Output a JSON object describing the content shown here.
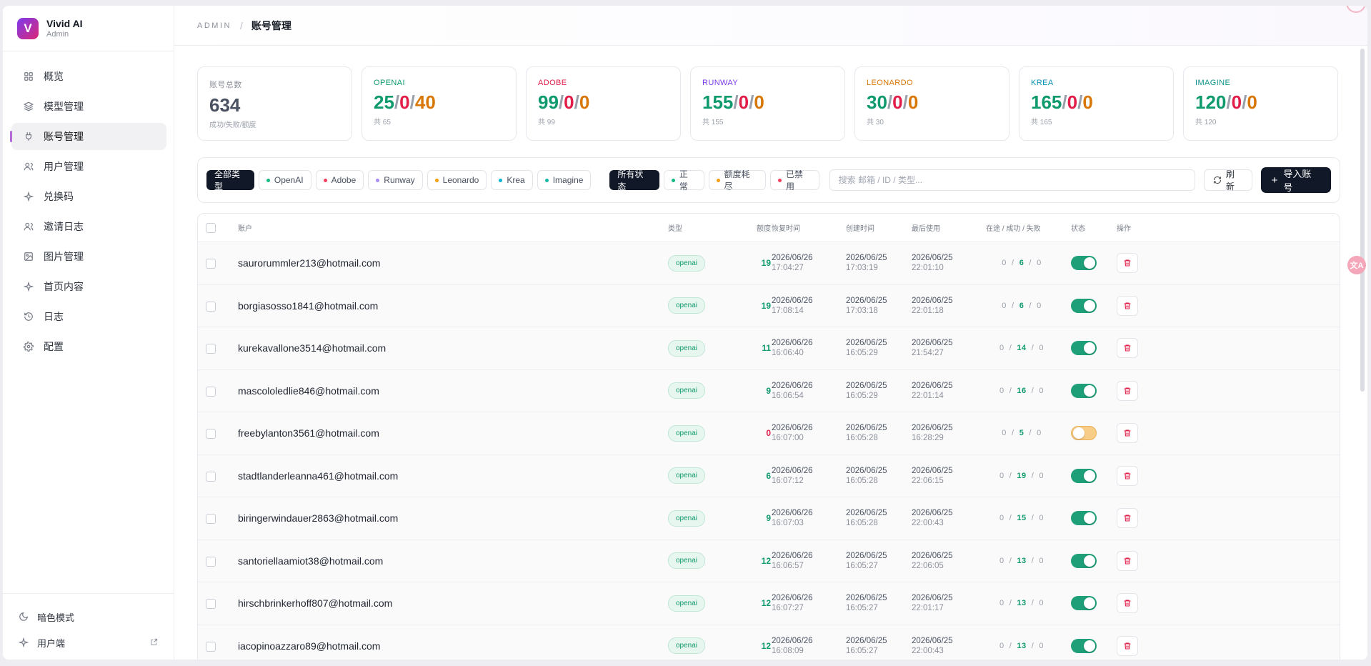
{
  "brand": {
    "name": "Vivid AI",
    "role": "Admin",
    "logo_letter": "V"
  },
  "nav": [
    {
      "label": "概览",
      "icon": "grid-icon",
      "active": false
    },
    {
      "label": "模型管理",
      "icon": "layers-icon",
      "active": false
    },
    {
      "label": "账号管理",
      "icon": "plug-icon",
      "active": true
    },
    {
      "label": "用户管理",
      "icon": "users-icon",
      "active": false
    },
    {
      "label": "兑换码",
      "icon": "sparkle-icon",
      "active": false
    },
    {
      "label": "邀请日志",
      "icon": "users-icon",
      "active": false
    },
    {
      "label": "图片管理",
      "icon": "image-icon",
      "active": false
    },
    {
      "label": "首页内容",
      "icon": "sparkle-icon",
      "active": false
    },
    {
      "label": "日志",
      "icon": "history-icon",
      "active": false
    },
    {
      "label": "配置",
      "icon": "gear-icon",
      "active": false
    }
  ],
  "sidebar_bottom": {
    "dark_mode": "暗色模式",
    "user_side": "用户端"
  },
  "breadcrumb": {
    "admin": "ADMIN",
    "sep": "/",
    "page": "账号管理"
  },
  "stats": [
    {
      "label": "账号总数",
      "label_color": "#8b8f99",
      "value_parts": [
        {
          "text": "634",
          "color": "#4a5160"
        }
      ],
      "sub": "成功/失败/额度"
    },
    {
      "label": "OPENAI",
      "label_color": "#0f9a6d",
      "value_parts": [
        {
          "text": "25",
          "color": "#0f9a6d"
        },
        {
          "text": "/",
          "color": "#9aa0aa"
        },
        {
          "text": "0",
          "color": "#e11d48"
        },
        {
          "text": "/",
          "color": "#9aa0aa"
        },
        {
          "text": "40",
          "color": "#d97706"
        }
      ],
      "sub": "共 65"
    },
    {
      "label": "ADOBE",
      "label_color": "#e11d48",
      "value_parts": [
        {
          "text": "99",
          "color": "#0f9a6d"
        },
        {
          "text": "/",
          "color": "#9aa0aa"
        },
        {
          "text": "0",
          "color": "#e11d48"
        },
        {
          "text": "/",
          "color": "#9aa0aa"
        },
        {
          "text": "0",
          "color": "#d97706"
        }
      ],
      "sub": "共 99"
    },
    {
      "label": "RUNWAY",
      "label_color": "#7c3aed",
      "value_parts": [
        {
          "text": "155",
          "color": "#0f9a6d"
        },
        {
          "text": "/",
          "color": "#9aa0aa"
        },
        {
          "text": "0",
          "color": "#e11d48"
        },
        {
          "text": "/",
          "color": "#9aa0aa"
        },
        {
          "text": "0",
          "color": "#d97706"
        }
      ],
      "sub": "共 155"
    },
    {
      "label": "LEONARDO",
      "label_color": "#d97706",
      "value_parts": [
        {
          "text": "30",
          "color": "#0f9a6d"
        },
        {
          "text": "/",
          "color": "#9aa0aa"
        },
        {
          "text": "0",
          "color": "#e11d48"
        },
        {
          "text": "/",
          "color": "#9aa0aa"
        },
        {
          "text": "0",
          "color": "#d97706"
        }
      ],
      "sub": "共 30"
    },
    {
      "label": "KREA",
      "label_color": "#0891b2",
      "value_parts": [
        {
          "text": "165",
          "color": "#0f9a6d"
        },
        {
          "text": "/",
          "color": "#9aa0aa"
        },
        {
          "text": "0",
          "color": "#e11d48"
        },
        {
          "text": "/",
          "color": "#9aa0aa"
        },
        {
          "text": "0",
          "color": "#d97706"
        }
      ],
      "sub": "共 165"
    },
    {
      "label": "IMAGINE",
      "label_color": "#0d9488",
      "value_parts": [
        {
          "text": "120",
          "color": "#0f9a6d"
        },
        {
          "text": "/",
          "color": "#9aa0aa"
        },
        {
          "text": "0",
          "color": "#e11d48"
        },
        {
          "text": "/",
          "color": "#9aa0aa"
        },
        {
          "text": "0",
          "color": "#d97706"
        }
      ],
      "sub": "共 120"
    }
  ],
  "type_filters": [
    {
      "label": "全部类型",
      "selected": true,
      "dot": ""
    },
    {
      "label": "OpenAI",
      "selected": false,
      "dot": "#10b981"
    },
    {
      "label": "Adobe",
      "selected": false,
      "dot": "#f43f5e"
    },
    {
      "label": "Runway",
      "selected": false,
      "dot": "#a78bfa"
    },
    {
      "label": "Leonardo",
      "selected": false,
      "dot": "#f59e0b"
    },
    {
      "label": "Krea",
      "selected": false,
      "dot": "#06b6d4"
    },
    {
      "label": "Imagine",
      "selected": false,
      "dot": "#14b8a6"
    }
  ],
  "status_filters": [
    {
      "label": "所有状态",
      "selected": true,
      "dot": ""
    },
    {
      "label": "正常",
      "selected": false,
      "dot": "#10b981"
    },
    {
      "label": "额度耗尽",
      "selected": false,
      "dot": "#f59e0b"
    },
    {
      "label": "已禁用",
      "selected": false,
      "dot": "#f43f5e"
    }
  ],
  "search": {
    "placeholder": "搜索 邮箱 / ID / 类型...",
    "value": ""
  },
  "buttons": {
    "refresh": "刷新",
    "import": "导入账号"
  },
  "table": {
    "headers": {
      "account": "账户",
      "type": "类型",
      "quota": "额度",
      "recover": "恢复时间",
      "created": "创建时间",
      "last_used": "最后使用",
      "counts": "在途 / 成功 / 失败",
      "status": "状态",
      "actions": "操作"
    },
    "rows": [
      {
        "email": "saurorummler213@hotmail.com",
        "type": "openai",
        "quota": "19",
        "recover_date": "2026/06/26",
        "recover_time": "17:04:27",
        "created_date": "2026/06/25",
        "created_time": "17:03:19",
        "last_date": "2026/06/25",
        "last_time": "22:01:10",
        "inflight": "0",
        "success": "6",
        "fail": "0",
        "enabled": true
      },
      {
        "email": "borgiasosso1841@hotmail.com",
        "type": "openai",
        "quota": "19",
        "recover_date": "2026/06/26",
        "recover_time": "17:08:14",
        "created_date": "2026/06/25",
        "created_time": "17:03:18",
        "last_date": "2026/06/25",
        "last_time": "22:01:18",
        "inflight": "0",
        "success": "6",
        "fail": "0",
        "enabled": true
      },
      {
        "email": "kurekavallone3514@hotmail.com",
        "type": "openai",
        "quota": "11",
        "recover_date": "2026/06/26",
        "recover_time": "16:06:40",
        "created_date": "2026/06/25",
        "created_time": "16:05:29",
        "last_date": "2026/06/25",
        "last_time": "21:54:27",
        "inflight": "0",
        "success": "14",
        "fail": "0",
        "enabled": true
      },
      {
        "email": "mascololedlie846@hotmail.com",
        "type": "openai",
        "quota": "9",
        "recover_date": "2026/06/26",
        "recover_time": "16:06:54",
        "created_date": "2026/06/25",
        "created_time": "16:05:29",
        "last_date": "2026/06/25",
        "last_time": "22:01:14",
        "inflight": "0",
        "success": "16",
        "fail": "0",
        "enabled": true
      },
      {
        "email": "freebylanton3561@hotmail.com",
        "type": "openai",
        "quota": "0",
        "recover_date": "2026/06/26",
        "recover_time": "16:07:00",
        "created_date": "2026/06/25",
        "created_time": "16:05:28",
        "last_date": "2026/06/25",
        "last_time": "16:28:29",
        "inflight": "0",
        "success": "5",
        "fail": "0",
        "enabled": false
      },
      {
        "email": "stadtlanderleanna461@hotmail.com",
        "type": "openai",
        "quota": "6",
        "recover_date": "2026/06/26",
        "recover_time": "16:07:12",
        "created_date": "2026/06/25",
        "created_time": "16:05:28",
        "last_date": "2026/06/25",
        "last_time": "22:06:15",
        "inflight": "0",
        "success": "19",
        "fail": "0",
        "enabled": true
      },
      {
        "email": "biringerwindauer2863@hotmail.com",
        "type": "openai",
        "quota": "9",
        "recover_date": "2026/06/26",
        "recover_time": "16:07:03",
        "created_date": "2026/06/25",
        "created_time": "16:05:28",
        "last_date": "2026/06/25",
        "last_time": "22:00:43",
        "inflight": "0",
        "success": "15",
        "fail": "0",
        "enabled": true
      },
      {
        "email": "santoriellaamiot38@hotmail.com",
        "type": "openai",
        "quota": "12",
        "recover_date": "2026/06/26",
        "recover_time": "16:06:57",
        "created_date": "2026/06/25",
        "created_time": "16:05:27",
        "last_date": "2026/06/25",
        "last_time": "22:06:05",
        "inflight": "0",
        "success": "13",
        "fail": "0",
        "enabled": true
      },
      {
        "email": "hirschbrinkerhoff807@hotmail.com",
        "type": "openai",
        "quota": "12",
        "recover_date": "2026/06/26",
        "recover_time": "16:07:27",
        "created_date": "2026/06/25",
        "created_time": "16:05:27",
        "last_date": "2026/06/25",
        "last_time": "22:01:17",
        "inflight": "0",
        "success": "13",
        "fail": "0",
        "enabled": true
      },
      {
        "email": "iacopinoazzaro89@hotmail.com",
        "type": "openai",
        "quota": "12",
        "recover_date": "2026/06/26",
        "recover_time": "16:08:09",
        "created_date": "2026/06/25",
        "created_time": "16:05:27",
        "last_date": "2026/06/25",
        "last_time": "22:00:43",
        "inflight": "0",
        "success": "13",
        "fail": "0",
        "enabled": true
      }
    ]
  },
  "floating_badge": "文A",
  "colors": {
    "accent": "#111827",
    "success": "#0f9a6d",
    "danger": "#e11d48",
    "warning": "#d97706",
    "nav_indicator": "#b56ad8"
  }
}
